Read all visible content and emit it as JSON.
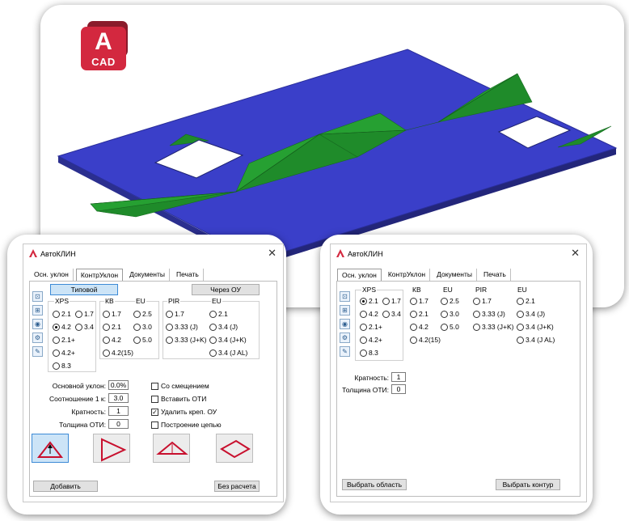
{
  "logo": {
    "letter": "A",
    "word": "CAD"
  },
  "colors": {
    "plate": "#3a3fc9",
    "slope": "#1f8b2a",
    "accent": "#d3283f",
    "selected": "#cce4f7"
  },
  "left_dialog": {
    "title": "АвтоКЛИН",
    "close": "✕",
    "tabs": [
      "Осн. уклон",
      "КонтрУклон",
      "Документы",
      "Печать"
    ],
    "active_tab": "КонтрУклон",
    "btn_typical": "Типовой",
    "btn_through": "Через ОУ",
    "xps_label": "XPS",
    "xps_options": [
      "2.1",
      "1.7",
      "4.2",
      "3.4",
      "2.1+",
      "4.2+",
      "8.3"
    ],
    "xps_selected": "4.2",
    "kb_label": "КВ",
    "kb_options": [
      "1.7",
      "2.1",
      "4.2",
      "4.2(15)"
    ],
    "eu_label": "EU",
    "eu_options": [
      "2.5",
      "3.0",
      "5.0"
    ],
    "pir_label": "PIR",
    "pir_options": [
      "1.7",
      "3.33 (J)",
      "3.33 (J+K)"
    ],
    "pir_eu_label": "EU",
    "pir_eu_options": [
      "2.1",
      "3.4 (J)",
      "3.4 (J+K)",
      "3.4 (J AL)"
    ],
    "fields": {
      "base_slope_label": "Основной уклон:",
      "base_slope_value": "0.0%",
      "ratio_label": "Соотношение 1 к:",
      "ratio_value": "3.0",
      "multiplicity_label": "Кратность:",
      "multiplicity_value": "1",
      "oti_label": "Толщина ОТИ:",
      "oti_value": "0"
    },
    "checks": [
      {
        "label": "Со смещением",
        "checked": false
      },
      {
        "label": "Вставить ОТИ",
        "checked": false
      },
      {
        "label": "Удалить креп. ОУ",
        "checked": true
      },
      {
        "label": "Построение цепью",
        "checked": false
      }
    ],
    "btn_add": "Добавить",
    "btn_no_calc": "Без расчета"
  },
  "right_dialog": {
    "title": "АвтоКЛИН",
    "close": "✕",
    "tabs": [
      "Осн. уклон",
      "КонтрУклон",
      "Документы",
      "Печать"
    ],
    "active_tab": "Осн. уклон",
    "xps_label": "XPS",
    "xps_options": [
      "2.1",
      "1.7",
      "4.2",
      "3.4",
      "2.1+",
      "4.2+",
      "8.3"
    ],
    "xps_selected": "2.1",
    "kb_label": "КВ",
    "kb_options": [
      "1.7",
      "2.1",
      "4.2",
      "4.2(15)"
    ],
    "eu_label": "EU",
    "eu_options": [
      "2.5",
      "3.0",
      "5.0"
    ],
    "pir_label": "PIR",
    "pir_options": [
      "1.7",
      "3.33 (J)",
      "3.33 (J+K)"
    ],
    "pir_eu_label": "EU",
    "pir_eu_options": [
      "2.1",
      "3.4 (J)",
      "3.4 (J+K)",
      "3.4 (J AL)"
    ],
    "fields": {
      "multiplicity_label": "Кратность:",
      "multiplicity_value": "1",
      "oti_label": "Толщина ОТИ:",
      "oti_value": "0"
    },
    "btn_select_area": "Выбрать область",
    "btn_select_contour": "Выбрать контур"
  }
}
